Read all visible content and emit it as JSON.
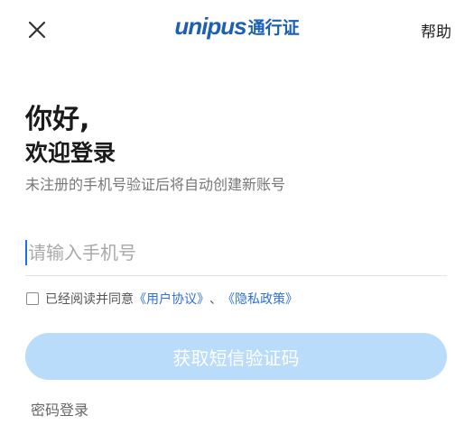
{
  "header": {
    "brand_logo": "unipus",
    "brand_suffix": "通行证",
    "help_label": "帮助",
    "brand_color": "#1b5fb6",
    "close_icon": "close-icon"
  },
  "greeting": {
    "line1": "你好,",
    "line2": "欢迎登录",
    "hint": "未注册的手机号验证后将自动创建新账号"
  },
  "phone": {
    "placeholder": "请输入手机号",
    "value": ""
  },
  "agreement": {
    "checked": false,
    "prefix": "已经阅读并同意",
    "user_agreement": "《用户协议》",
    "separator": "、",
    "privacy_policy": "《隐私政策》",
    "link_color": "#2f6fd6"
  },
  "actions": {
    "get_code_label": "获取短信验证码",
    "button_color": "#b9dcfa",
    "password_login_label": "密码登录"
  }
}
